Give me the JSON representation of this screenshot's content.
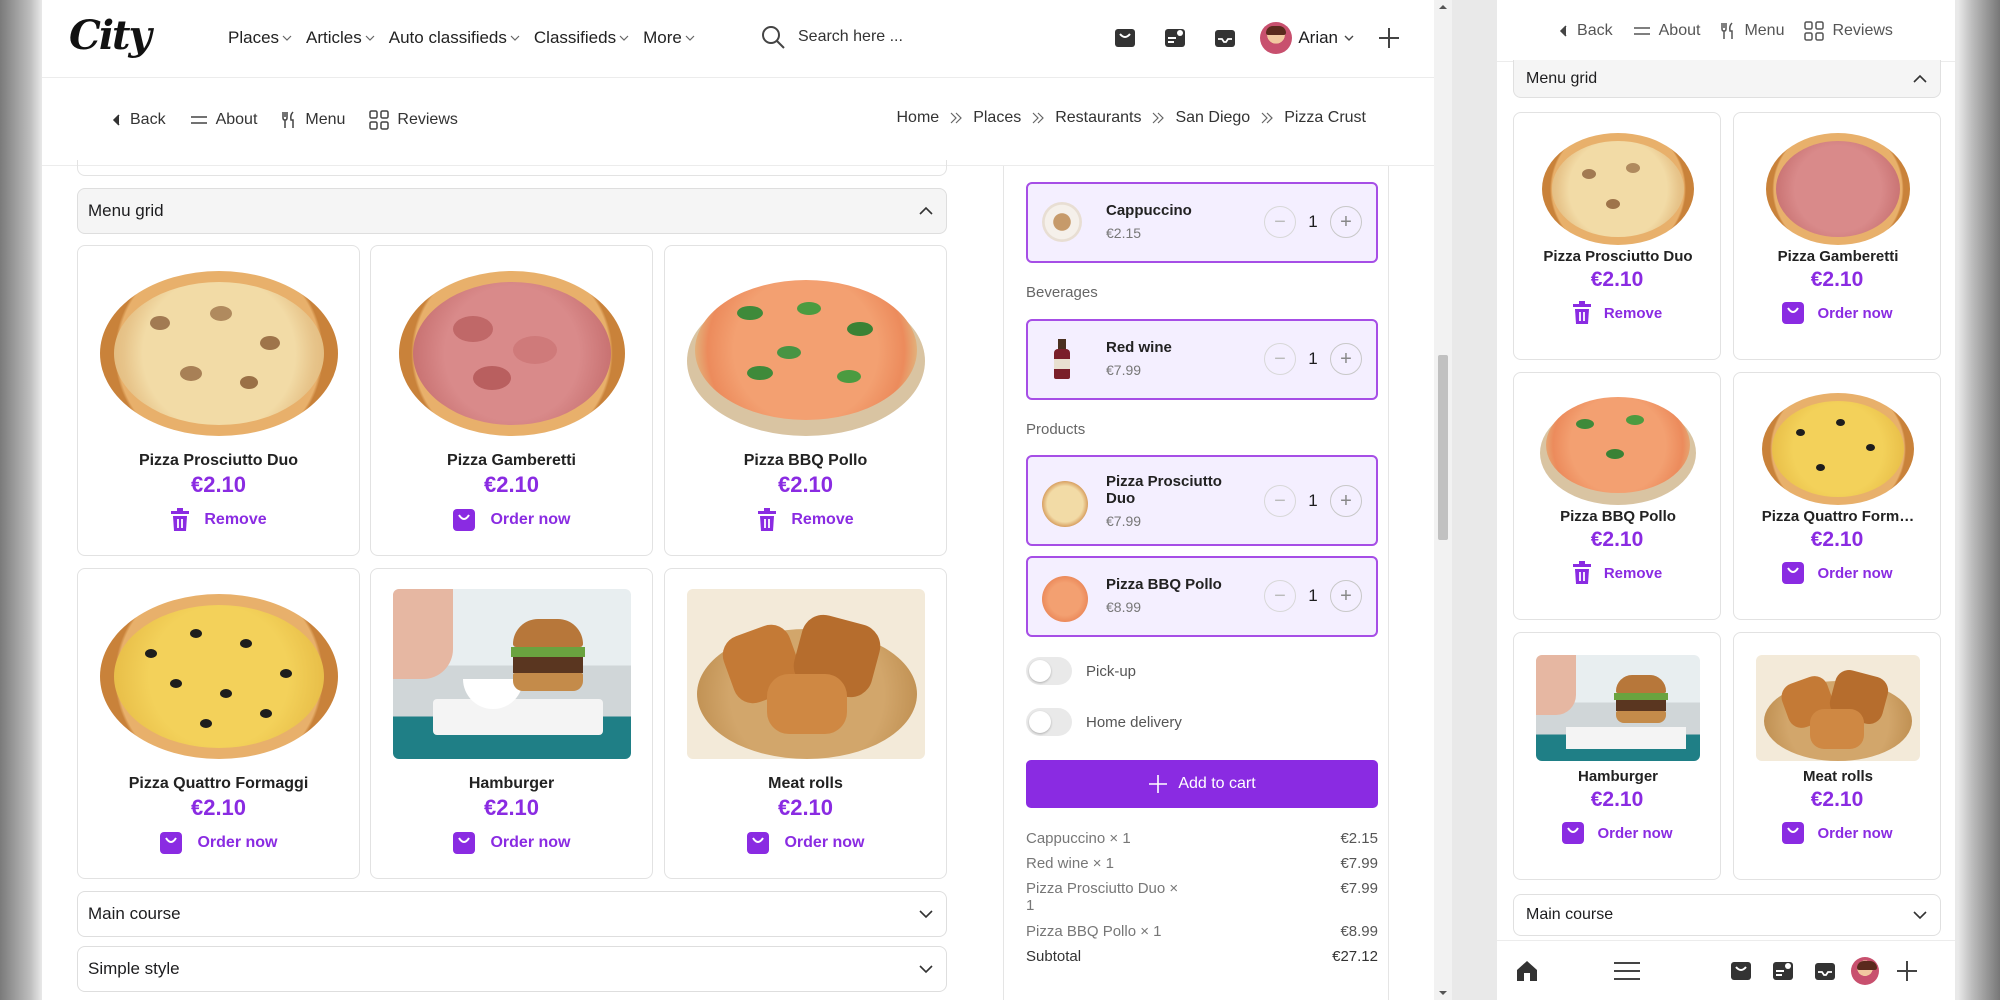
{
  "brand": {
    "logo": "City"
  },
  "topnav": {
    "items": [
      "Places",
      "Articles",
      "Auto classifieds",
      "Classifieds",
      "More"
    ],
    "search_placeholder": "Search here ...",
    "user_name": "Arian"
  },
  "pagenav": {
    "back": "Back",
    "about": "About",
    "menu": "Menu",
    "reviews": "Reviews"
  },
  "breadcrumb": [
    "Home",
    "Places",
    "Restaurants",
    "San Diego",
    "Pizza Crust"
  ],
  "menu_grid": {
    "title": "Menu grid",
    "items": [
      {
        "name": "Pizza Prosciutto Duo",
        "price": "€2.10",
        "action": "Remove"
      },
      {
        "name": "Pizza Gamberetti",
        "price": "€2.10",
        "action": "Order now"
      },
      {
        "name": "Pizza BBQ Pollo",
        "price": "€2.10",
        "action": "Remove"
      },
      {
        "name": "Pizza Quattro Formaggi",
        "price": "€2.10",
        "action": "Order now"
      },
      {
        "name": "Hamburger",
        "price": "€2.10",
        "action": "Order now"
      },
      {
        "name": "Meat rolls",
        "price": "€2.10",
        "action": "Order now"
      }
    ]
  },
  "sections": {
    "main_course": "Main course",
    "simple_style": "Simple style"
  },
  "order": {
    "groups": {
      "beverages": "Beverages",
      "products": "Products"
    },
    "items": [
      {
        "name": "Cappuccino",
        "price": "€2.15",
        "qty": "1"
      },
      {
        "name": "Red wine",
        "price": "€7.99",
        "qty": "1"
      },
      {
        "name": "Pizza Prosciutto Duo",
        "price": "€7.99",
        "qty": "1"
      },
      {
        "name": "Pizza BBQ Pollo",
        "price": "€8.99",
        "qty": "1"
      }
    ],
    "pickup": "Pick-up",
    "delivery": "Home delivery",
    "add_to_cart": "Add to cart",
    "summary": [
      {
        "label": "Cappuccino × 1",
        "value": "€2.15"
      },
      {
        "label": "Red wine × 1",
        "value": "€7.99"
      },
      {
        "label": "Pizza Prosciutto Duo × 1",
        "value": "€7.99"
      },
      {
        "label": "Pizza BBQ Pollo × 1",
        "value": "€8.99"
      }
    ],
    "subtotal_label": "Subtotal",
    "subtotal_value": "€27.12"
  },
  "mobile": {
    "grid_items": [
      {
        "name": "Pizza Prosciutto Duo",
        "price": "€2.10",
        "action": "Remove"
      },
      {
        "name": "Pizza Gamberetti",
        "price": "€2.10",
        "action": "Order now"
      },
      {
        "name": "Pizza BBQ Pollo",
        "price": "€2.10",
        "action": "Remove"
      },
      {
        "name": "Pizza Quattro Form…",
        "price": "€2.10",
        "action": "Order now"
      },
      {
        "name": "Hamburger",
        "price": "€2.10",
        "action": "Order now"
      },
      {
        "name": "Meat rolls",
        "price": "€2.10",
        "action": "Order now"
      }
    ]
  },
  "colors": {
    "accent": "#8a2be2",
    "selected_bg": "#f4efff",
    "selected_border": "#a64ee6"
  }
}
